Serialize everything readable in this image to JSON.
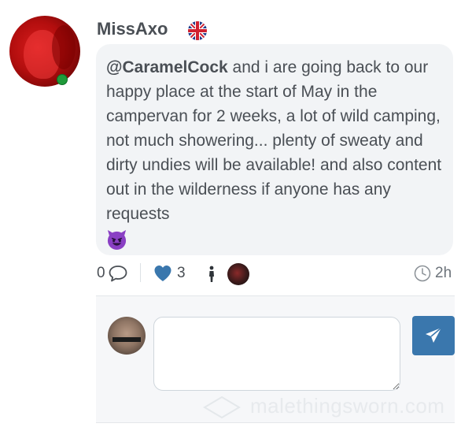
{
  "post": {
    "username": "MissAxo",
    "flag_icon": "uk-flag-icon",
    "mention": "@CaramelCock",
    "text": " and i are going back to our happy place at the start of May in the campervan for 2 weeks, a lot of wild camping, not much showering... plenty of sweaty and dirty undies will be available! and also content out in the wilderness if anyone has any requests",
    "emoji_icon": "smiling-devil-emoji-icon",
    "online_status_color": "#1f9a3a"
  },
  "actions": {
    "comment_count": "0",
    "like_count": "3",
    "time_ago": "2h",
    "like_color": "#3a77ad"
  },
  "comment": {
    "input_placeholder": "",
    "send_button_color": "#3a77ad"
  },
  "watermark": {
    "text": "malethingsworn.com"
  }
}
